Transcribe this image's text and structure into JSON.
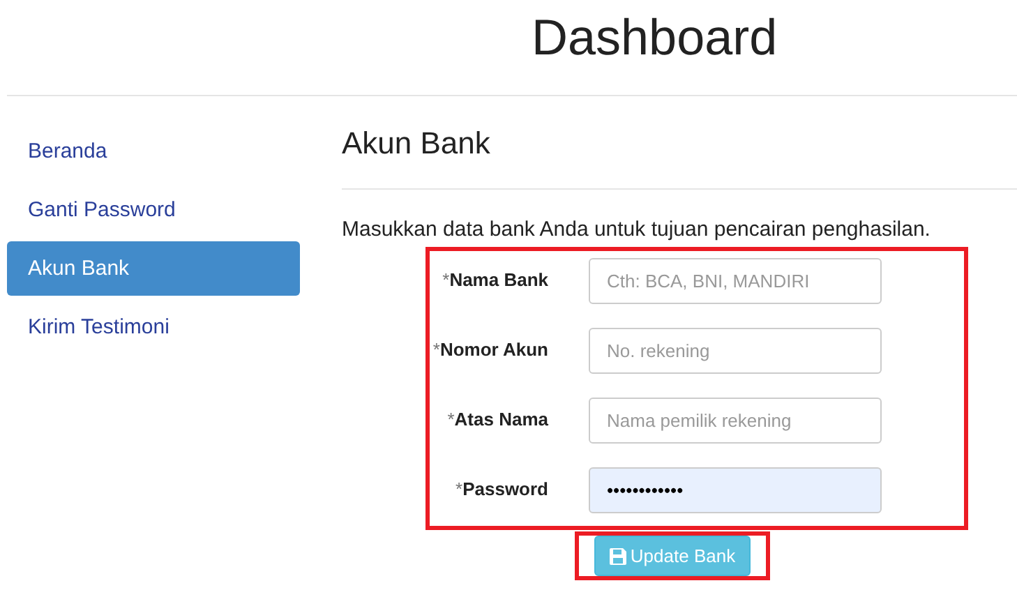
{
  "header": {
    "title": "Dashboard"
  },
  "sidebar": {
    "items": [
      {
        "label": "Beranda",
        "selected": false
      },
      {
        "label": "Ganti Password",
        "selected": false
      },
      {
        "label": "Akun Bank",
        "selected": true
      },
      {
        "label": "Kirim Testimoni",
        "selected": false
      }
    ]
  },
  "main": {
    "heading": "Akun Bank",
    "intro": "Masukkan data bank Anda untuk tujuan pencairan penghasilan.",
    "form": {
      "highlighted": true,
      "fields": [
        {
          "mark": "*",
          "label": "Nama Bank",
          "placeholder": "Cth: BCA, BNI, MANDIRI",
          "autofilled": false
        },
        {
          "mark": "*",
          "label": "Nomor Akun",
          "placeholder": "No. rekening",
          "autofilled": false
        },
        {
          "mark": "*",
          "label": "Atas Nama",
          "placeholder": "Nama pemilik rekening",
          "autofilled": false
        },
        {
          "mark": "*",
          "label": "Password",
          "value": "••••••••••••",
          "autofilled": true
        }
      ]
    },
    "submit": {
      "label": "Update Bank",
      "highlighted": true
    }
  }
}
